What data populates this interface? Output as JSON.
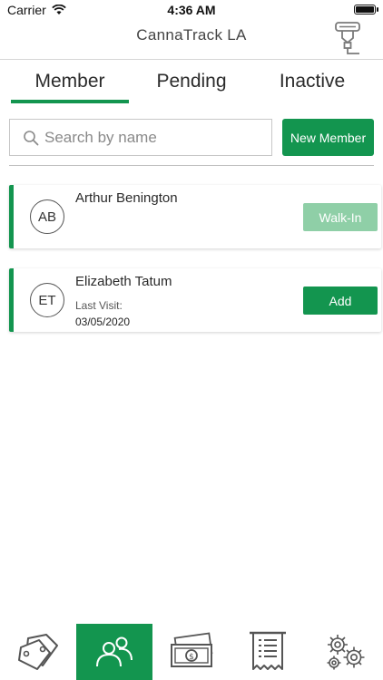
{
  "status_bar": {
    "carrier": "Carrier",
    "time": "4:36 AM"
  },
  "header": {
    "title": "CannaTrack LA",
    "action_icon": "scanner-icon"
  },
  "tabs": [
    {
      "label": "Member",
      "selected": true
    },
    {
      "label": "Pending",
      "selected": false
    },
    {
      "label": "Inactive",
      "selected": false
    }
  ],
  "search": {
    "placeholder": "Search by name",
    "value": ""
  },
  "new_member_label": "New Member",
  "members": [
    {
      "initials": "AB",
      "name": "Arthur Benington",
      "button_label": "Walk-In"
    },
    {
      "initials": "ET",
      "name": "Elizabeth Tatum",
      "last_visit_label": "Last Visit:",
      "last_visit_value": "03/05/2020",
      "button_label": "Add"
    }
  ],
  "bottom_tabs": [
    {
      "icon": "tags-icon",
      "active": false
    },
    {
      "icon": "members-icon",
      "active": true
    },
    {
      "icon": "cash-icon",
      "active": false
    },
    {
      "icon": "receipt-icon",
      "active": false
    },
    {
      "icon": "settings-gears-icon",
      "active": false
    }
  ],
  "colors": {
    "accent": "#13954f",
    "accent_disabled": "#8fcfa7"
  }
}
